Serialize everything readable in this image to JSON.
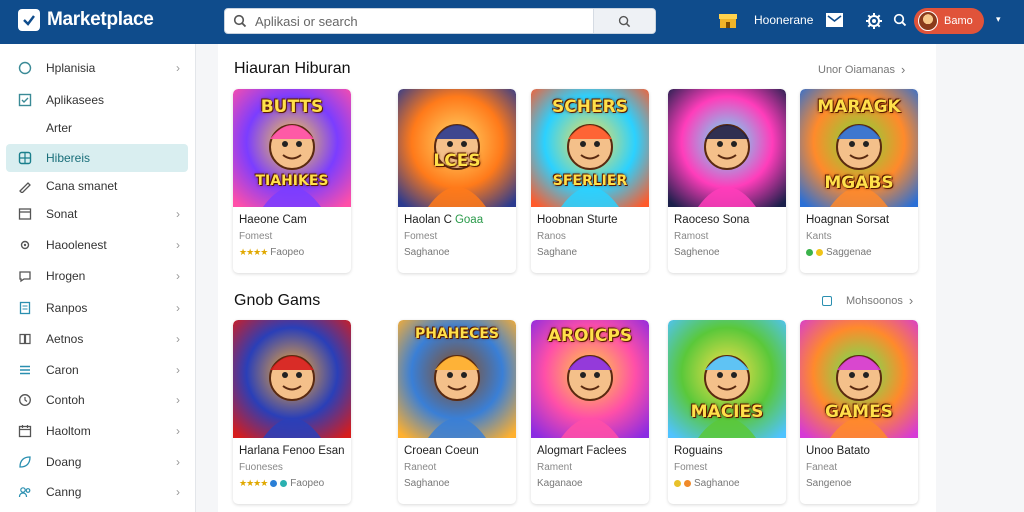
{
  "app": {
    "name": "Marketplace",
    "search_placeholder": "Aplikasi or search",
    "header_label": "Hoonerane",
    "user_label": "Bamo"
  },
  "sidebar": {
    "items": [
      {
        "label": "Hplanisia",
        "icon": "circle-icon",
        "chevron": "›"
      },
      {
        "label": "Aplikasees",
        "icon": "check-square-icon",
        "chevron": ""
      },
      {
        "label": "Arter",
        "icon": "",
        "chevron": ""
      },
      {
        "label": "Hibereis",
        "icon": "grid-icon",
        "chevron": "",
        "active": true
      },
      {
        "label": "Cana smanet",
        "icon": "pencil-icon",
        "chevron": ""
      },
      {
        "label": "Sonat",
        "icon": "window-icon",
        "chevron": "›"
      },
      {
        "label": "Haoolenest",
        "icon": "settings-icon",
        "chevron": "›"
      },
      {
        "label": "Hrogen",
        "icon": "chat-icon",
        "chevron": "›"
      },
      {
        "label": "Ranpos",
        "icon": "document-icon",
        "chevron": "›"
      },
      {
        "label": "Aetnos",
        "icon": "book-icon",
        "chevron": "›"
      },
      {
        "label": "Caron",
        "icon": "list-icon",
        "chevron": "›"
      },
      {
        "label": "Contoh",
        "icon": "clock-icon",
        "chevron": "›"
      },
      {
        "label": "Haoltom",
        "icon": "calendar-icon",
        "chevron": "›"
      },
      {
        "label": "Doang",
        "icon": "leaf-icon",
        "chevron": "›"
      },
      {
        "label": "Canng",
        "icon": "people-icon",
        "chevron": "›"
      }
    ]
  },
  "sections": [
    {
      "title": "Hiauran Hiburan",
      "link": "Unor Oiamanas",
      "link_chevron": "›",
      "cards": [
        {
          "image_text": [
            "BUTTS",
            "TIAHIKES"
          ],
          "title": "Haeone Cam",
          "sub": "Fomest",
          "meta": "Faopeo",
          "stars": "★★★★",
          "badge": ""
        },
        {
          "image_text": [
            "LCES"
          ],
          "title": "Haolan C",
          "title_green": "Goaa",
          "sub": "Fomest",
          "meta": "Saghanoe",
          "stars": "",
          "badge": ""
        },
        {
          "image_text": [
            "SCHERS",
            "SFERLIER"
          ],
          "title": "Hoobnan Sturte",
          "sub": "Ranos",
          "meta": "Saghane",
          "stars": "",
          "badge": ""
        },
        {
          "image_text": [],
          "title": "Raoceso Sona",
          "sub": "Ramost",
          "meta": "Saghenoe",
          "stars": "",
          "badge": ""
        },
        {
          "image_text": [
            "MARAGK",
            "MGABS"
          ],
          "title": "Hoagnan Sorsat",
          "sub": "Kants",
          "meta": "Saggenae",
          "stars": "",
          "badge": "green-yellow"
        }
      ]
    },
    {
      "title": "Gnob Gams",
      "link": "Mohsoonos",
      "link_chevron": "›",
      "cards": [
        {
          "image_text": [],
          "title": "Harlana Fenoo Esan",
          "sub": "Fuoneses",
          "meta": "Faopeo",
          "stars": "★★★★",
          "badge": "blue-teal"
        },
        {
          "image_text": [
            "PHAHECES"
          ],
          "title": "Croean Coeun",
          "sub": "Raneot",
          "meta": "Saghanoe",
          "stars": "",
          "badge": ""
        },
        {
          "image_text": [
            "AROICPS"
          ],
          "title": "Alogmart Faclees",
          "sub": "Rament",
          "meta": "Kaganaoe",
          "stars": "",
          "badge": ""
        },
        {
          "image_text": [
            "MACIES"
          ],
          "title": "Roguains",
          "sub": "Fomest",
          "meta": "Saghanoe",
          "stars": "",
          "badge": "yellow-orange"
        },
        {
          "image_text": [
            "GAMES"
          ],
          "title": "Unoo Batato",
          "sub": "Faneat",
          "meta": "Sangenoe",
          "stars": "",
          "badge": ""
        }
      ]
    }
  ]
}
